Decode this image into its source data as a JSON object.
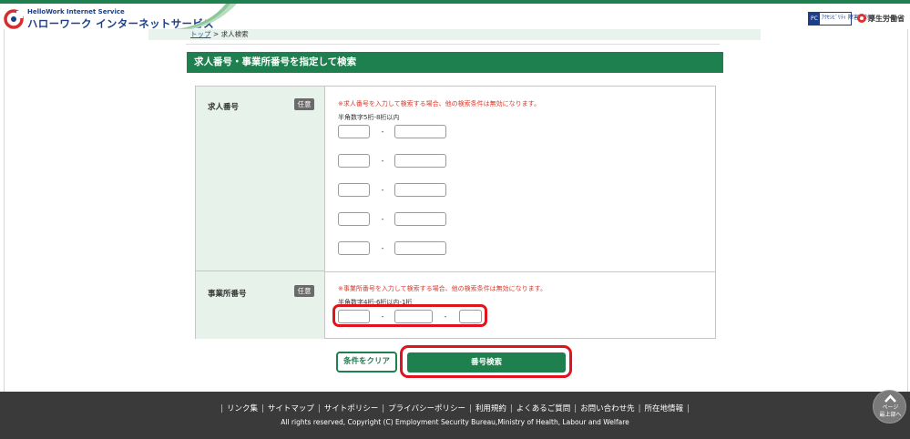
{
  "header": {
    "logo_small": "HelloWork Internet Service",
    "logo_big": "ハローワーク インターネットサービス",
    "pc_badge_label": "PC",
    "pc_badge_text": "ｱｸｾｼﾋﾞﾘﾃｨ 障害者対応",
    "ministry_name": "厚生労働省"
  },
  "breadcrumb": {
    "top_link": "トップ",
    "separator": ">",
    "current": "求人検索"
  },
  "section": {
    "title": "求人番号・事業所番号を指定して検索"
  },
  "form": {
    "job_number": {
      "label": "求人番号",
      "badge": "任意",
      "notice": "※求人番号を入力して検索する場合、他の検索条件は無効になります。",
      "hint": "半角数字5桁-8桁以内",
      "rows": [
        {
          "part1": "",
          "part2": ""
        },
        {
          "part1": "",
          "part2": ""
        },
        {
          "part1": "",
          "part2": ""
        },
        {
          "part1": "",
          "part2": ""
        },
        {
          "part1": "",
          "part2": ""
        }
      ],
      "dash": "-"
    },
    "office_number": {
      "label": "事業所番号",
      "badge": "任意",
      "notice": "※事業所番号を入力して検索する場合、他の検索条件は無効になります。",
      "hint": "半角数字4桁-6桁以内-1桁",
      "part1": "",
      "part2": "",
      "part3": "",
      "dash": "-"
    }
  },
  "buttons": {
    "clear": "条件をクリア",
    "search": "番号検索"
  },
  "footer": {
    "links": [
      "リンク集",
      "サイトマップ",
      "サイトポリシー",
      "プライバシーポリシー",
      "利用規約",
      "よくあるご質問",
      "お問い合わせ先",
      "所在地情報"
    ],
    "separator": "|",
    "copyright": "All rights reserved, Copyright (C) Employment Security Bureau,Ministry of Health, Labour and Welfare"
  },
  "back_to_top": {
    "line1": "ページ",
    "line2": "最上部へ"
  },
  "colors": {
    "brand_green": "#1e7f4f",
    "highlight_red": "#e0141e",
    "notice_red": "#d83a2a",
    "footer_bg": "#3a3a3a"
  }
}
